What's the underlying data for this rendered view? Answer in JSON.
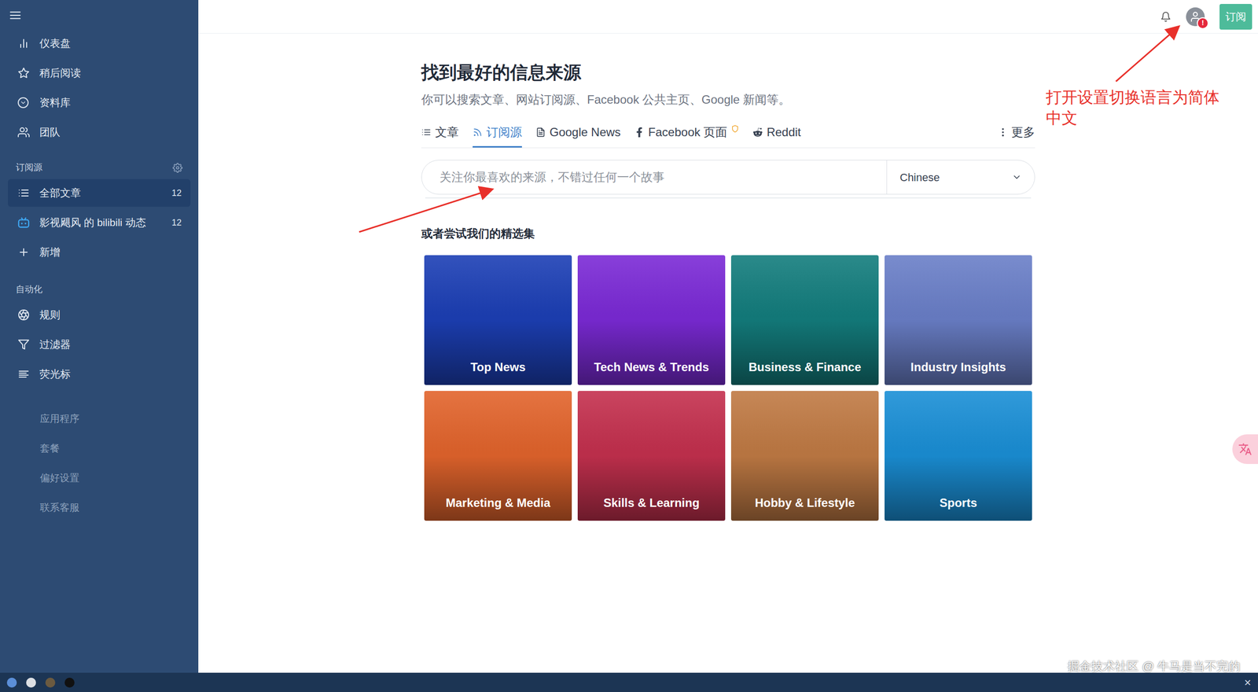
{
  "sidebar": {
    "nav": [
      {
        "label": "仪表盘"
      },
      {
        "label": "稍后阅读"
      },
      {
        "label": "资料库"
      },
      {
        "label": "团队"
      }
    ],
    "feeds": {
      "title": "订阅源",
      "items": [
        {
          "label": "全部文章",
          "count": "12",
          "selected": true
        },
        {
          "label": "影视飓风 的 bilibili 动态",
          "count": "12",
          "selected": false
        },
        {
          "label": "新增",
          "selected": false
        }
      ]
    },
    "automation": {
      "title": "自动化",
      "items": [
        {
          "label": "规则"
        },
        {
          "label": "过滤器"
        },
        {
          "label": "荧光标"
        }
      ]
    },
    "links": [
      "应用程序",
      "套餐",
      "偏好设置",
      "联系客服"
    ]
  },
  "topbar": {
    "alert_badge": "!",
    "subscribe_button": "订阅"
  },
  "main": {
    "title": "找到最好的信息来源",
    "subtitle": "你可以搜索文章、网站订阅源、Facebook 公共主页、Google 新闻等。",
    "tabs": [
      {
        "label": "文章",
        "selected": false
      },
      {
        "label": "订阅源",
        "selected": true
      },
      {
        "label": "Google News",
        "selected": false
      },
      {
        "label": "Facebook 页面",
        "selected": false
      },
      {
        "label": "Reddit",
        "selected": false
      }
    ],
    "more": "更多",
    "search": {
      "placeholder": "关注你最喜欢的来源，不错过任何一个故事",
      "language": "Chinese"
    },
    "collections_title": "或者尝试我们的精选集",
    "collections": [
      {
        "label": "Top News",
        "color": "#1c3fb5"
      },
      {
        "label": "Tech News & Trends",
        "color": "#7b2ad6"
      },
      {
        "label": "Business & Finance",
        "color": "#137d7d"
      },
      {
        "label": "Industry Insights",
        "color": "#6a7fc8"
      },
      {
        "label": "Marketing & Media",
        "color": "#e2642c"
      },
      {
        "label": "Skills & Learning",
        "color": "#c4304e"
      },
      {
        "label": "Hobby & Lifestyle",
        "color": "#c07a44"
      },
      {
        "label": "Sports",
        "color": "#1a8fd6"
      }
    ]
  },
  "annotation": {
    "text": "打开设置切换语言为简体中文"
  },
  "watermark": "掘金技术社区 @ 牛马是当不完的",
  "taskbar": {
    "dots": [
      {
        "color": "#5b8fd8"
      },
      {
        "color": "#dcdfe4"
      },
      {
        "color": "#6b5a40"
      },
      {
        "color": "#111111"
      }
    ],
    "close": "×"
  }
}
